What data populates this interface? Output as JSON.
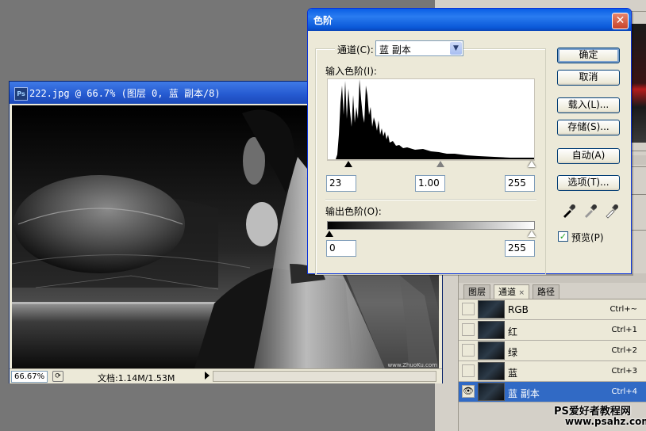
{
  "document": {
    "title": "222.jpg @ 66.7% (图层 0, 蓝 副本/8)",
    "ps_icon": "Ps",
    "zoom": "66.67%",
    "doc_size": "文档:1.14M/1.53M",
    "watermark": "www.ZhuoKu.com"
  },
  "levels_dialog": {
    "title": "色阶",
    "channel_label": "通道(C):",
    "channel_value": "蓝 副本",
    "input_levels_label": "输入色阶(I):",
    "input_black": "23",
    "input_gamma": "1.00",
    "input_white": "255",
    "output_levels_label": "输出色阶(O):",
    "output_black": "0",
    "output_white": "255",
    "buttons": {
      "ok": "确定",
      "cancel": "取消",
      "load": "载入(L)...",
      "save": "存储(S)...",
      "auto": "自动(A)",
      "options": "选项(T)..."
    },
    "preview_label": "预览(P)",
    "preview_checked": true
  },
  "panel": {
    "tabs": [
      "图层",
      "通道",
      "路径"
    ],
    "active_tab": "通道",
    "tab_close": "×",
    "channels": [
      {
        "name": "RGB",
        "shortcut": "Ctrl+~",
        "visible": false,
        "selected": false
      },
      {
        "name": "红",
        "shortcut": "Ctrl+1",
        "visible": false,
        "selected": false
      },
      {
        "name": "绿",
        "shortcut": "Ctrl+2",
        "visible": false,
        "selected": false
      },
      {
        "name": "蓝",
        "shortcut": "Ctrl+3",
        "visible": false,
        "selected": false
      },
      {
        "name": "蓝 副本",
        "shortcut": "Ctrl+4",
        "visible": true,
        "selected": true
      }
    ]
  },
  "site_watermark": {
    "line1": "PS爱好者教程网",
    "line2": "www.psahz.com"
  }
}
